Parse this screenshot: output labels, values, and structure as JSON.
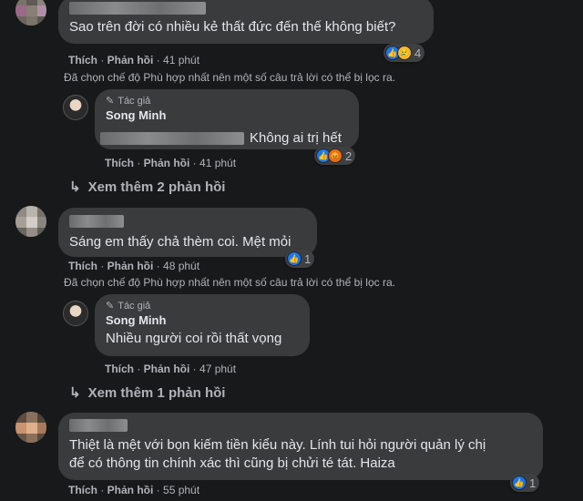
{
  "c1": {
    "text": "Sao trên đời có nhiều kẻ thất đức đến thế không biết?",
    "like": "Thích",
    "reply": "Phản hồi",
    "time": "41 phút",
    "reaction_count": "4",
    "note": "Đã chọn chế độ Phù hợp nhất nên một số câu trả lời có thể bị lọc ra."
  },
  "r1": {
    "author_tag": "Tác giả",
    "name": "Song Minh",
    "text": "Không ai trị hết",
    "like": "Thích",
    "reply": "Phản hồi",
    "time": "41 phút",
    "reaction_count": "2"
  },
  "more1": "Xem thêm 2 phản hồi",
  "c2": {
    "text": "Sáng em thấy chả thèm coi. Mệt mỏi",
    "like": "Thích",
    "reply": "Phản hồi",
    "time": "48 phút",
    "reaction_count": "1",
    "note": "Đã chọn chế độ Phù hợp nhất nên một số câu trả lời có thể bị lọc ra."
  },
  "r2": {
    "author_tag": "Tác giả",
    "name": "Song Minh",
    "text": "Nhiều người coi rồi thất vọng",
    "like": "Thích",
    "reply": "Phản hồi",
    "time": "47 phút"
  },
  "more2": "Xem thêm 1 phản hồi",
  "c3": {
    "line1": "Thiệt là mệt với bọn kiếm tiền kiểu này. Lính tui hỏi người quản lý chị",
    "line2": "để có thông tin chính xác thì cũng bị chửi té tát. Haiza",
    "like": "Thích",
    "reply": "Phản hồi",
    "time": "55 phút",
    "reaction_count": "1"
  },
  "icons": {
    "like": "like-icon",
    "sad": "sad-icon",
    "angry": "angry-icon",
    "pen": "pen-icon",
    "arrow": "reply-arrow-icon"
  },
  "colors": {
    "background": "#18191a",
    "bubble": "#3a3b3c",
    "like": "#1877f2",
    "sad": "#f7b928",
    "angry": "#e9710f"
  }
}
